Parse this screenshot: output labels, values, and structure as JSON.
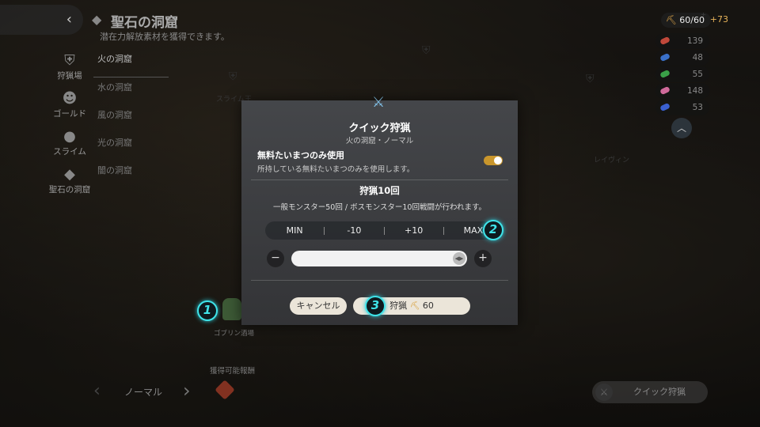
{
  "header": {
    "title": "聖石の洞窟",
    "subtitle": "潜在力解放素材を獲得できます。"
  },
  "side_nav": {
    "items": [
      {
        "label": "狩猟場",
        "icon": "shield-icon"
      },
      {
        "label": "ゴールド",
        "icon": "goblin-icon"
      },
      {
        "label": "スライム",
        "icon": "slime-icon"
      },
      {
        "label": "聖石の洞窟",
        "icon": "stone-icon"
      }
    ]
  },
  "cave_list": {
    "items": [
      "火の洞窟",
      "水の洞窟",
      "風の洞窟",
      "光の洞窟",
      "闇の洞窟"
    ],
    "active_index": 0
  },
  "resources": {
    "stamina": "60/60",
    "stamina_plus_mark": "+",
    "stamina_bonus": "+73",
    "items": [
      {
        "value": "139",
        "color": "#c0483a"
      },
      {
        "value": "48",
        "color": "#3a70c8"
      },
      {
        "value": "55",
        "color": "#3aa048"
      },
      {
        "value": "148",
        "color": "#d06a9a"
      },
      {
        "value": "53",
        "color": "#3a60d0"
      }
    ]
  },
  "map": {
    "labels": [
      "スライム王",
      "ゴブリン酒場",
      "レイヴィン"
    ]
  },
  "bottom": {
    "difficulty": "ノーマル",
    "rewards_label": "獲得可能報酬",
    "quick_hunt_label": "クイック狩猟"
  },
  "callouts": [
    "1",
    "2",
    "3"
  ],
  "modal": {
    "title": "クイック狩猟",
    "subtitle": "火の洞窟・ノーマル",
    "free_label": "無料たいまつのみ使用",
    "free_desc": "所持している無料たいまつのみを使用します。",
    "free_toggle_on": true,
    "hunt_count": "狩猟10回",
    "hunt_desc": "一般モンスター50回 / ボスモンスター10回戦闘が行われます。",
    "presets": [
      "MIN",
      "-10",
      "+10",
      "MAX"
    ],
    "slider_fraction": 1.0,
    "minus": "−",
    "plus": "+",
    "cancel_label": "キャンセル",
    "confirm_label": "狩猟",
    "confirm_cost": "60"
  }
}
